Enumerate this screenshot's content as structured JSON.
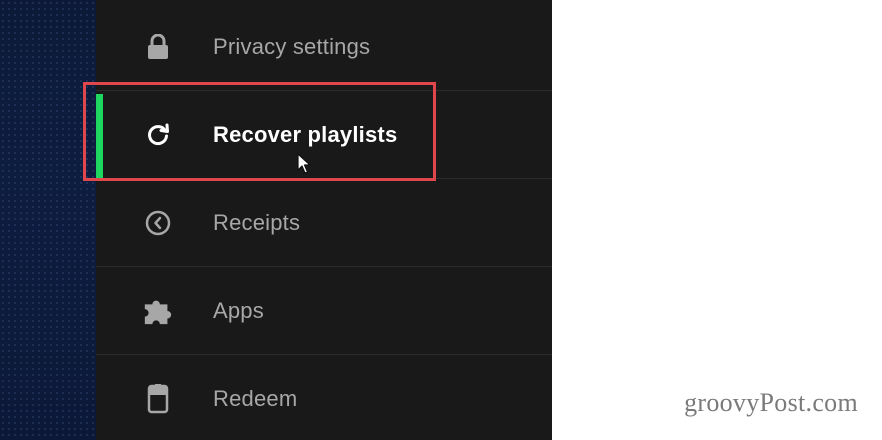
{
  "menu": {
    "items": [
      {
        "label": "Privacy settings",
        "icon": "lock-icon",
        "active": false
      },
      {
        "label": "Recover playlists",
        "icon": "refresh-icon",
        "active": true
      },
      {
        "label": "Receipts",
        "icon": "clock-back-icon",
        "active": false
      },
      {
        "label": "Apps",
        "icon": "puzzle-icon",
        "active": false
      },
      {
        "label": "Redeem",
        "icon": "gift-card-icon",
        "active": false
      }
    ]
  },
  "colors": {
    "active_indicator": "#1ed760",
    "highlight_box": "#e0474c",
    "menu_background": "#191919"
  },
  "watermark": "groovyPost.com"
}
